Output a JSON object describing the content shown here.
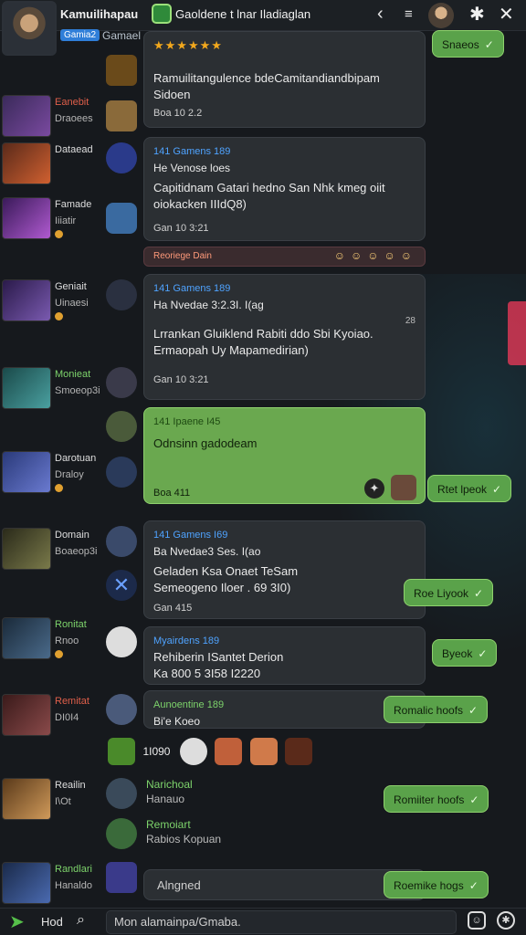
{
  "header": {
    "username": "Kamuilihapau",
    "badge": "Gamia2",
    "game": "Gamael",
    "channel_title": "Gaoldene t lnar Iladiaglan",
    "back_icon": "chevron-left-icon",
    "menu_icon": "menu-icon"
  },
  "sidebar": {
    "items": [
      {
        "name": "Eanebit",
        "sub": "Draoees"
      },
      {
        "name": "Dataead",
        "sub": ""
      },
      {
        "name": "Famade",
        "sub": "Iiiatir"
      },
      {
        "name": "Geniait",
        "sub": "Uinaesi"
      },
      {
        "name": "Monieat",
        "sub": "Smoeop3i"
      },
      {
        "name": "Darotuan",
        "sub": "Draloy"
      },
      {
        "name": "Domain",
        "sub": "Boaeop3i"
      },
      {
        "name": "Ronitat",
        "sub": "Rnoo"
      },
      {
        "name": "Remitat",
        "sub": "DI0I4"
      },
      {
        "name": "Reailin",
        "sub": "I\\Ot"
      },
      {
        "name": "Randlari",
        "sub": "Hanaldo"
      }
    ]
  },
  "messages": {
    "m1": {
      "stars": "★★★★★★",
      "body": "Ramuilitangulence bdeCamitandiandbipam Sidoen",
      "meta": "Boa 10 2.2"
    },
    "m2": {
      "head": "141 Gamens 189",
      "sub": "He Venose loes",
      "body": "Capitidnam Gatari hedno San Nhk kmeg oiit oiokacken IIIdQ8)",
      "meta": "Gan 10 3:21"
    },
    "reaction_bar": "Reoriege Dain",
    "m3": {
      "head": "141 Gamens 189",
      "sub": "Ha Nvedae 3:2.3I. I(ag",
      "body": "Lrrankan Gluiklend Rabiti ddo Sbi Kyoiao. Ermaopah Uy Mapamedirian)",
      "meta": "Gan 10 3:21",
      "side_num": "28"
    },
    "m4": {
      "head": "141 Ipaene I45",
      "body": "Odnsinn gadodeam",
      "meta": "Boa 411"
    },
    "m5": {
      "head": "141 Gamens I69",
      "sub": "Ba Nvedae3 Ses. I(ao",
      "line1": "Geladen Ksa Onaet TeSam",
      "line2": "Semeogeno Iloer . 69 3I0)",
      "meta": "Gan 415"
    },
    "m6": {
      "head": "Myairdens 189",
      "line1": "Rehiberin ISantet Derion",
      "line2": "Ka 800 5 3I58 I2220",
      "meta": ""
    },
    "m7": {
      "head": "Aunoentine 189",
      "line1": "Bi'e Koeo"
    },
    "m8": {
      "count": "1I090"
    },
    "m9": {
      "name": "Narichoal",
      "sub": "Hanauo"
    },
    "m10": {
      "name": "Remoiart",
      "sub": "Rabios Kopuan"
    }
  },
  "pills": {
    "p1": "Snaeos",
    "p2": "Rtet lpeok",
    "p3": "Roe Liyook",
    "p4": "Byeok",
    "p5": "Romalic hoofs",
    "p6": "Romiiter hoofs",
    "p7": "Roemike hogs"
  },
  "reply": {
    "placeholder": "Alngned"
  },
  "footer": {
    "label": "Hod",
    "input_placeholder": "Mon alamainpa/Gmaba."
  }
}
